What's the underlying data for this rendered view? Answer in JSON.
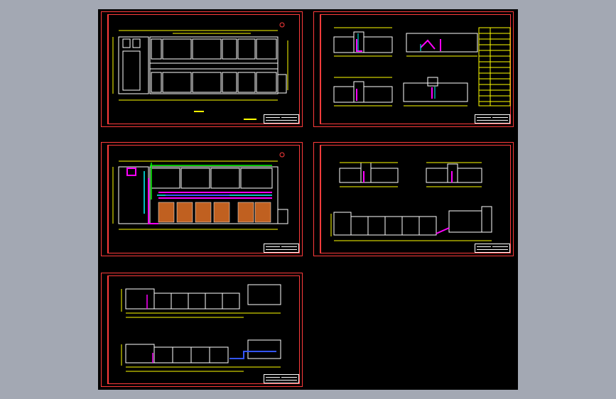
{
  "viewer": {
    "background_color": "#a3a8b3",
    "canvas_color": "#000000"
  },
  "colors": {
    "border": "#ff3b3b",
    "wall": "#ffffff",
    "dimension": "#ffff00",
    "pipe_magenta": "#ff00ff",
    "pipe_cyan": "#00ffff",
    "pipe_green": "#00ff00",
    "pipe_blue": "#3355ff",
    "hatch": "#c06020"
  },
  "sheets": [
    {
      "id": "plan-1",
      "type": "floor-plan"
    },
    {
      "id": "sections-1",
      "type": "sections-with-table"
    },
    {
      "id": "plan-2",
      "type": "pipe-plan"
    },
    {
      "id": "sections-2",
      "type": "sections"
    },
    {
      "id": "profile",
      "type": "elevation-profile"
    }
  ]
}
